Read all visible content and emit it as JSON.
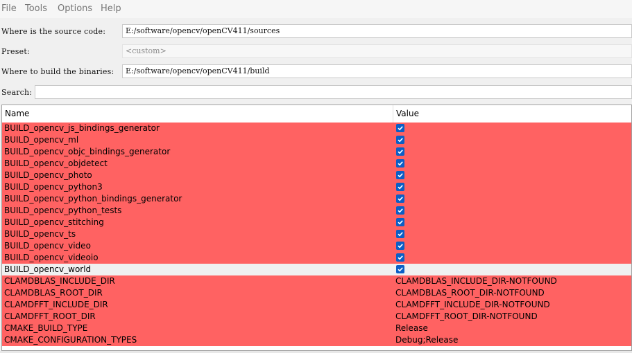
{
  "menu": {
    "file": "File",
    "tools": "Tools",
    "options": "Options",
    "help": "Help"
  },
  "form": {
    "source_label": "Where is the source code:",
    "source_value": "E:/software/opencv/openCV411/sources",
    "preset_label": "Preset:",
    "preset_value": "<custom>",
    "build_label": "Where to build the binaries:",
    "build_value": "E:/software/opencv/openCV411/build",
    "search_label": "Search:",
    "search_value": ""
  },
  "table": {
    "headers": {
      "name": "Name",
      "value": "Value"
    },
    "rows": [
      {
        "name": "BUILD_opencv_js_bindings_generator",
        "type": "bool",
        "checked": true
      },
      {
        "name": "BUILD_opencv_ml",
        "type": "bool",
        "checked": true
      },
      {
        "name": "BUILD_opencv_objc_bindings_generator",
        "type": "bool",
        "checked": true
      },
      {
        "name": "BUILD_opencv_objdetect",
        "type": "bool",
        "checked": true
      },
      {
        "name": "BUILD_opencv_photo",
        "type": "bool",
        "checked": true
      },
      {
        "name": "BUILD_opencv_python3",
        "type": "bool",
        "checked": true
      },
      {
        "name": "BUILD_opencv_python_bindings_generator",
        "type": "bool",
        "checked": true
      },
      {
        "name": "BUILD_opencv_python_tests",
        "type": "bool",
        "checked": true
      },
      {
        "name": "BUILD_opencv_stitching",
        "type": "bool",
        "checked": true
      },
      {
        "name": "BUILD_opencv_ts",
        "type": "bool",
        "checked": true
      },
      {
        "name": "BUILD_opencv_video",
        "type": "bool",
        "checked": true
      },
      {
        "name": "BUILD_opencv_videoio",
        "type": "bool",
        "checked": true
      },
      {
        "name": "BUILD_opencv_world",
        "type": "bool",
        "checked": true,
        "selected": true
      },
      {
        "name": "CLAMDBLAS_INCLUDE_DIR",
        "type": "text",
        "value": "CLAMDBLAS_INCLUDE_DIR-NOTFOUND"
      },
      {
        "name": "CLAMDBLAS_ROOT_DIR",
        "type": "text",
        "value": "CLAMDBLAS_ROOT_DIR-NOTFOUND"
      },
      {
        "name": "CLAMDFFT_INCLUDE_DIR",
        "type": "text",
        "value": "CLAMDFFT_INCLUDE_DIR-NOTFOUND"
      },
      {
        "name": "CLAMDFFT_ROOT_DIR",
        "type": "text",
        "value": "CLAMDFFT_ROOT_DIR-NOTFOUND"
      },
      {
        "name": "CMAKE_BUILD_TYPE",
        "type": "text",
        "value": "Release"
      },
      {
        "name": "CMAKE_CONFIGURATION_TYPES",
        "type": "text",
        "value": "Debug;Release"
      }
    ]
  },
  "colors": {
    "new_entry_bg": "#ff6262",
    "selected_row_bg": "#f0f0f0",
    "checkbox": "#0b5fc6"
  },
  "icons": {
    "checkbox_checked": "check-icon"
  }
}
